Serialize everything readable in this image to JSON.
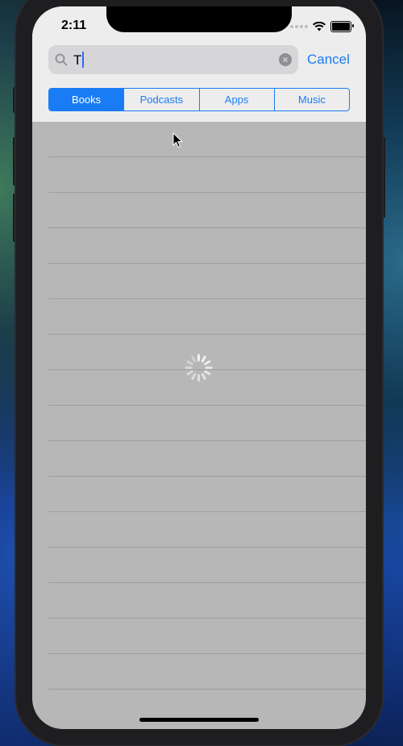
{
  "status_bar": {
    "time": "2:11",
    "icons": [
      "cellular-dots-icon",
      "wifi-icon",
      "battery-icon"
    ]
  },
  "search": {
    "value": "T",
    "placeholder": "Search",
    "cancel_label": "Cancel"
  },
  "scope_bar": {
    "segments": [
      {
        "label": "Books",
        "selected": true
      },
      {
        "label": "Podcasts",
        "selected": false
      },
      {
        "label": "Apps",
        "selected": false
      },
      {
        "label": "Music",
        "selected": false
      }
    ]
  },
  "results": {
    "state": "loading"
  },
  "colors": {
    "accent": "#1a7cf5",
    "header_bg": "#ededed",
    "list_bg": "#b7b7b7"
  }
}
